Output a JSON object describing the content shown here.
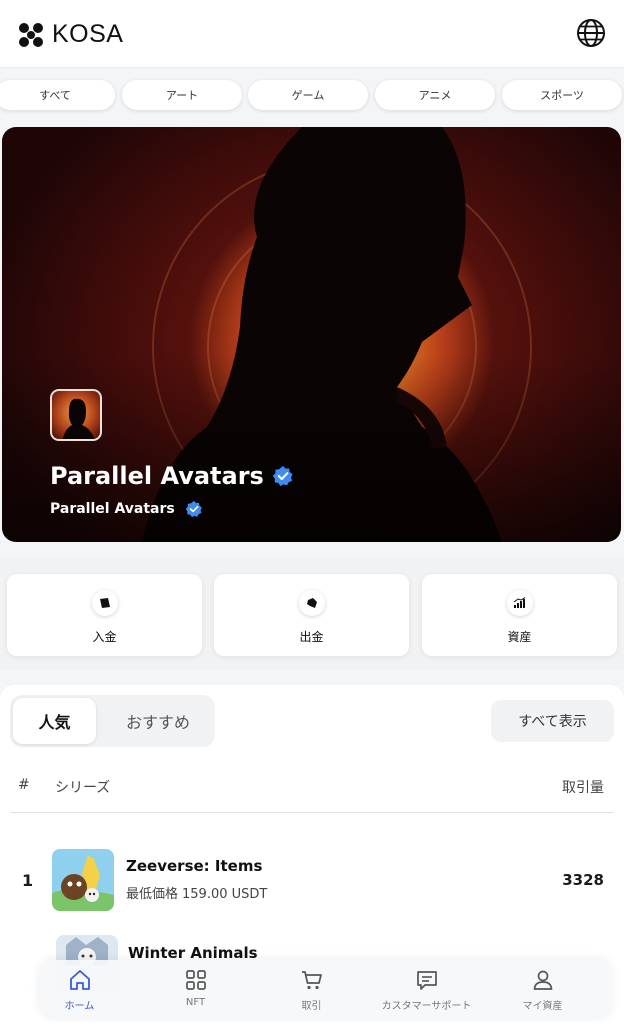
{
  "header": {
    "brand": "KOSA",
    "logo_icon": "kosa-logo-icon",
    "language_icon": "globe-icon"
  },
  "categories": [
    "すべて",
    "アート",
    "ゲーム",
    "アニメ",
    "スポーツ"
  ],
  "banner": {
    "title": "Parallel Avatars",
    "subtitle": "Parallel Avatars",
    "verified_icon": "verified-badge-icon"
  },
  "actions": [
    {
      "label": "入金",
      "icon": "deposit-icon"
    },
    {
      "label": "出金",
      "icon": "withdraw-icon"
    },
    {
      "label": "資産",
      "icon": "assets-chart-icon"
    }
  ],
  "ranking": {
    "tabs": {
      "active": "人気",
      "inactive": "おすすめ"
    },
    "show_all": "すべて表示",
    "columns": {
      "rank": "#",
      "series": "シリーズ",
      "volume": "取引量"
    },
    "rows": [
      {
        "rank": "1",
        "name": "Zeeverse: Items",
        "min_label": "最低価格",
        "min_price": "159.00 USDT",
        "volume": "3328"
      },
      {
        "rank": "",
        "name": "Winter Animals",
        "min_label": "",
        "min_price": "",
        "volume": ""
      }
    ]
  },
  "tabbar": {
    "items": [
      {
        "label": "ホーム",
        "icon": "home-icon",
        "active": true
      },
      {
        "label": "NFT",
        "icon": "grid-icon",
        "active": false
      },
      {
        "label": "取引",
        "icon": "cart-icon",
        "active": false
      },
      {
        "label": "カスタマーサポート",
        "icon": "support-message-icon",
        "active": false
      },
      {
        "label": "マイ資産",
        "icon": "user-icon",
        "active": false
      }
    ],
    "active_color": "#3b5ad8"
  },
  "colors": {
    "verified": "#3f8bf0",
    "banner_glow": "#f0a642"
  }
}
